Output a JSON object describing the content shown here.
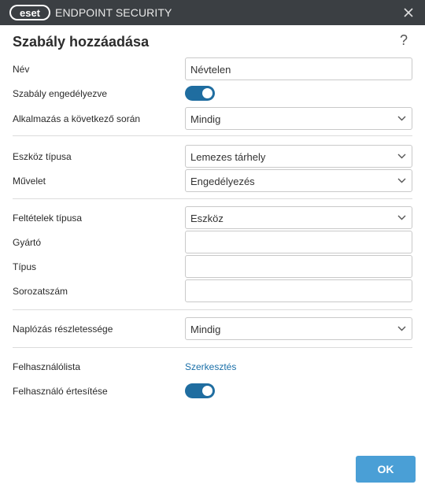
{
  "titlebar": {
    "logo_text": "eset",
    "app_name": "ENDPOINT SECURITY",
    "close_icon": "close-icon"
  },
  "dialog": {
    "title": "Szabály hozzáadása",
    "help_label": "?"
  },
  "form": {
    "name": {
      "label": "Név",
      "value": "Névtelen"
    },
    "rule_enabled": {
      "label": "Szabály engedélyezve",
      "on": true
    },
    "apply_during": {
      "label": "Alkalmazás a következő során",
      "value": "Mindig"
    },
    "device_type": {
      "label": "Eszköz típusa",
      "value": "Lemezes tárhely"
    },
    "action": {
      "label": "Művelet",
      "value": "Engedélyezés"
    },
    "criteria_type": {
      "label": "Feltételek típusa",
      "value": "Eszköz"
    },
    "vendor": {
      "label": "Gyártó",
      "value": ""
    },
    "model": {
      "label": "Típus",
      "value": ""
    },
    "serial": {
      "label": "Sorozatszám",
      "value": ""
    },
    "logging": {
      "label": "Naplózás részletessége",
      "value": "Mindig"
    },
    "user_list": {
      "label": "Felhasználólista",
      "link": "Szerkesztés"
    },
    "notify_user": {
      "label": "Felhasználó értesítése",
      "on": true
    }
  },
  "footer": {
    "ok_label": "OK"
  },
  "colors": {
    "titlebar": "#3b3f43",
    "toggle_on": "#1f6da0",
    "link": "#1a6fa8",
    "ok_button": "#4a9fd6"
  }
}
